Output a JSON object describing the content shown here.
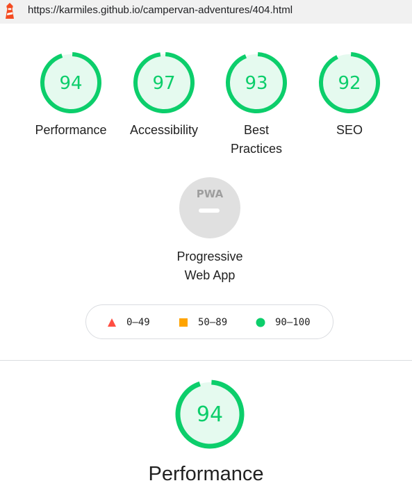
{
  "browser": {
    "url": "https://karmiles.github.io/campervan-adventures/404.html",
    "favicon": "lighthouse-icon"
  },
  "categories": [
    {
      "id": "performance",
      "label": "Performance",
      "score": "94",
      "value": 0.94
    },
    {
      "id": "accessibility",
      "label": "Accessibility",
      "score": "97",
      "value": 0.97
    },
    {
      "id": "best-practices",
      "label": "Best Practices",
      "score": "93",
      "value": 0.93
    },
    {
      "id": "seo",
      "label": "SEO",
      "score": "92",
      "value": 0.92
    }
  ],
  "pwa": {
    "label": "Progressive Web App",
    "badge_text": "PWA"
  },
  "legend": [
    {
      "range": "0–49",
      "shape": "triangle",
      "color": "#ff4e42"
    },
    {
      "range": "50–89",
      "shape": "square",
      "color": "#ffa400"
    },
    {
      "range": "90–100",
      "shape": "circle",
      "color": "#0cce6b"
    }
  ],
  "detail": {
    "score": "94",
    "value": 0.94,
    "title": "Performance"
  },
  "colors": {
    "pass": "#0cce6b",
    "pass_bg": "#e5faef",
    "pwa_gray": "#e0e0e0",
    "pwa_text": "#9e9e9e"
  }
}
